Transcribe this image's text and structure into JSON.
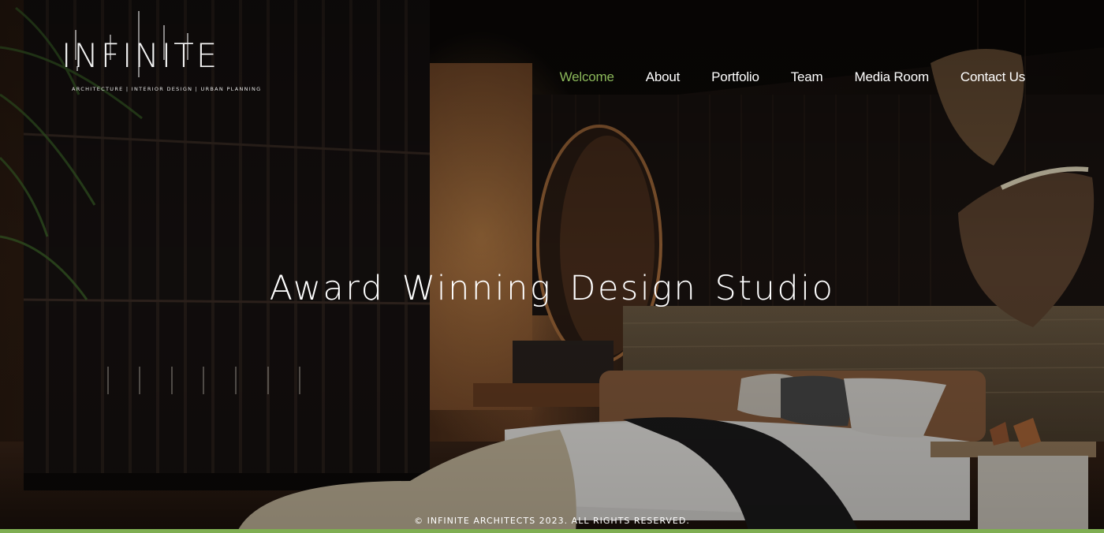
{
  "brand": {
    "logo_text": "INFINITE",
    "tagline": "ARCHITECTURE | INTERIOR DESIGN | URBAN PLANNING"
  },
  "nav": {
    "items": [
      {
        "label": "Welcome",
        "active": true
      },
      {
        "label": "About",
        "active": false
      },
      {
        "label": "Portfolio",
        "active": false
      },
      {
        "label": "Team",
        "active": false
      },
      {
        "label": "Media Room",
        "active": false
      },
      {
        "label": "Contact Us",
        "active": false
      }
    ]
  },
  "hero": {
    "title": "Award Winning Design Studio"
  },
  "footer": {
    "copyright": "© INFINITE ARCHITECTS 2023. ALL RIGHTS RESERVED."
  },
  "colors": {
    "accent": "#8bb85a",
    "nav_text": "#ffffff",
    "footer_bar": "#7fae52"
  }
}
